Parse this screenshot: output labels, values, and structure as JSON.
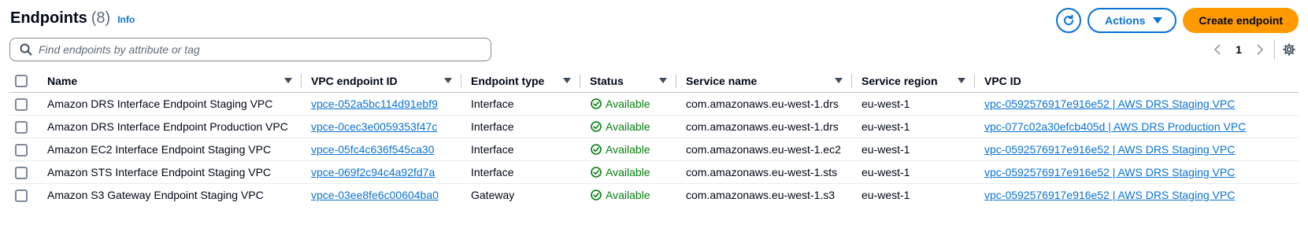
{
  "header": {
    "title": "Endpoints",
    "count": "(8)",
    "info": "Info"
  },
  "toolbar": {
    "actions_label": "Actions",
    "create_label": "Create endpoint"
  },
  "search": {
    "placeholder": "Find endpoints by attribute or tag"
  },
  "pagination": {
    "current_page": "1"
  },
  "table": {
    "columns": [
      "Name",
      "VPC endpoint ID",
      "Endpoint type",
      "Status",
      "Service name",
      "Service region",
      "VPC ID"
    ],
    "rows": [
      {
        "name": "Amazon DRS Interface Endpoint Staging VPC",
        "endpoint_id": "vpce-052a5bc114d91ebf9",
        "type": "Interface",
        "status": "Available",
        "service": "com.amazonaws.eu-west-1.drs",
        "region": "eu-west-1",
        "vpc": "vpc-0592576917e916e52 | AWS DRS Staging VPC"
      },
      {
        "name": "Amazon DRS Interface Endpoint Production VPC",
        "endpoint_id": "vpce-0cec3e0059353f47c",
        "type": "Interface",
        "status": "Available",
        "service": "com.amazonaws.eu-west-1.drs",
        "region": "eu-west-1",
        "vpc": "vpc-077c02a30efcb405d | AWS DRS Production VPC"
      },
      {
        "name": "Amazon EC2 Interface Endpoint Staging VPC",
        "endpoint_id": "vpce-05fc4c636f545ca30",
        "type": "Interface",
        "status": "Available",
        "service": "com.amazonaws.eu-west-1.ec2",
        "region": "eu-west-1",
        "vpc": "vpc-0592576917e916e52 | AWS DRS Staging VPC"
      },
      {
        "name": "Amazon STS Interface Endpoint Staging VPC",
        "endpoint_id": "vpce-069f2c94c4a92fd7a",
        "type": "Interface",
        "status": "Available",
        "service": "com.amazonaws.eu-west-1.sts",
        "region": "eu-west-1",
        "vpc": "vpc-0592576917e916e52 | AWS DRS Staging VPC"
      },
      {
        "name": "Amazon S3 Gateway Endpoint Staging VPC",
        "endpoint_id": "vpce-03ee8fe6c00604ba0",
        "type": "Gateway",
        "status": "Available",
        "service": "com.amazonaws.eu-west-1.s3",
        "region": "eu-west-1",
        "vpc": "vpc-0592576917e916e52 | AWS DRS Staging VPC"
      }
    ]
  },
  "colors": {
    "link": "#0972d3",
    "primary_button": "#ff9900",
    "status_ok": "#037f0c"
  },
  "icons": {
    "refresh": "refresh-icon",
    "settings": "gear-icon",
    "search": "search-icon",
    "status": "check-circle-icon"
  }
}
